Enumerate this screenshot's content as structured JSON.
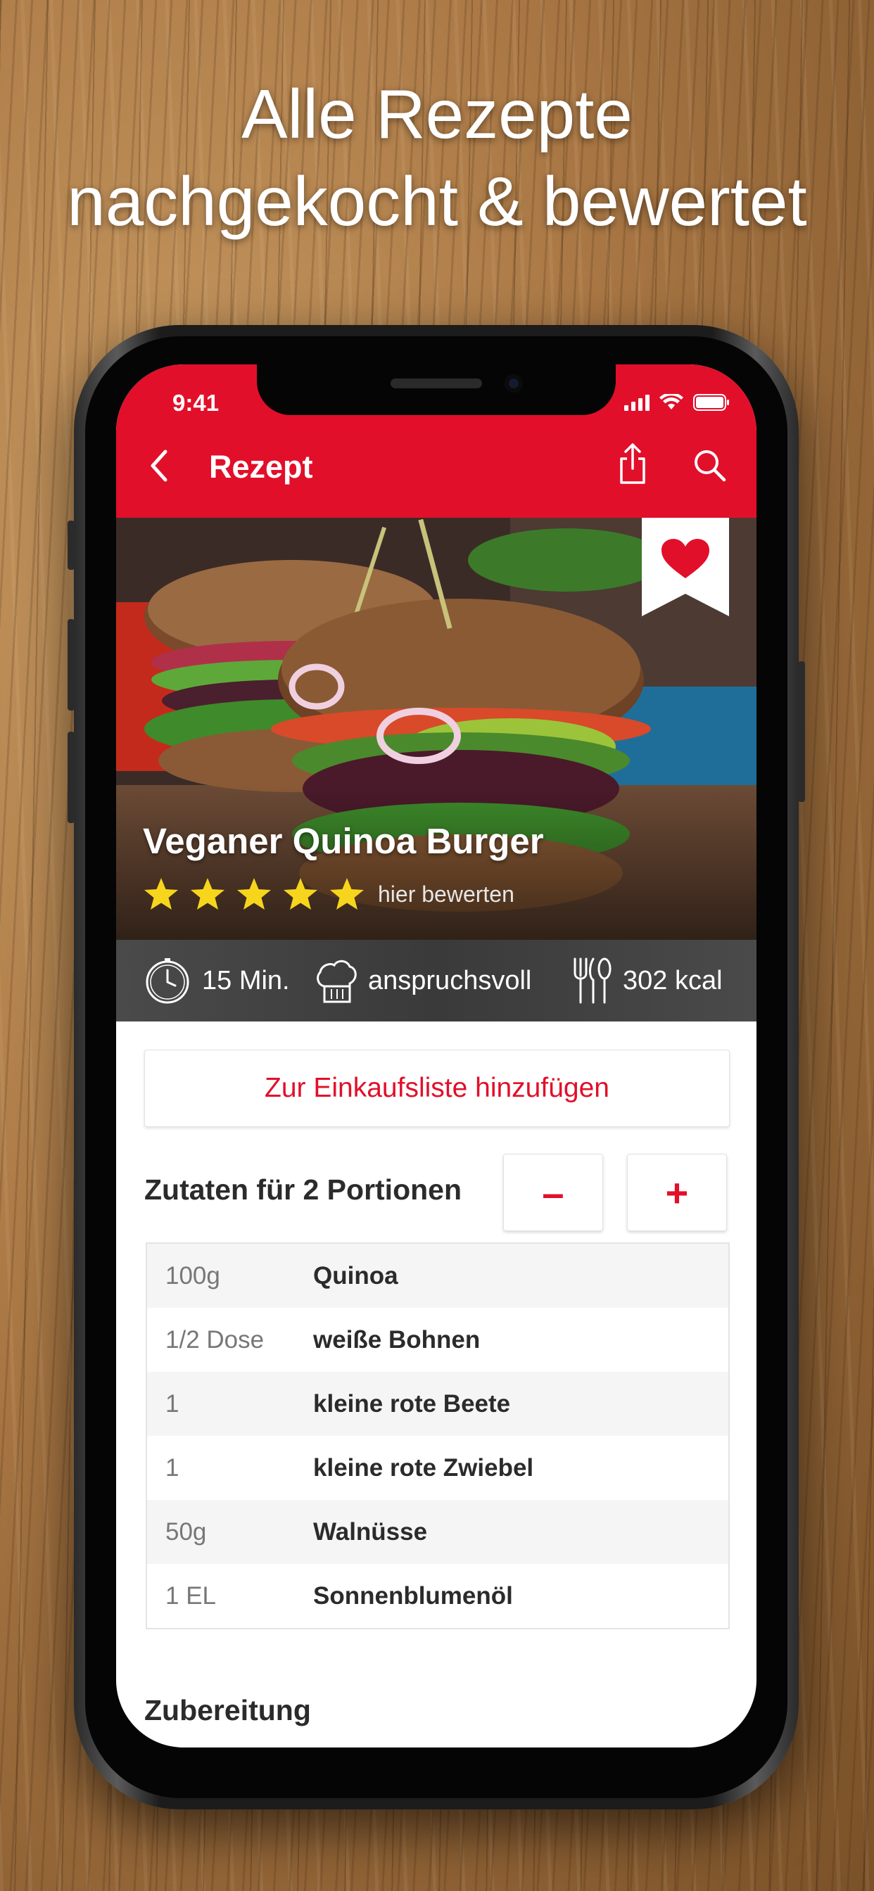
{
  "headline": {
    "line1": "Alle Rezepte",
    "line2": "nachgekocht & bewertet"
  },
  "status_bar": {
    "time": "9:41"
  },
  "nav": {
    "title": "Rezept"
  },
  "recipe": {
    "title": "Veganer Quinoa Burger",
    "rating_stars": 5,
    "rate_label": "hier bewerten",
    "favorite": true
  },
  "stats": {
    "time": "15 Min.",
    "difficulty": "anspruchsvoll",
    "calories": "302 kcal"
  },
  "shopping_list_button": "Zur Einkaufsliste hinzufügen",
  "ingredients": {
    "heading": "Zutaten für 2 Portionen",
    "decrease_label": "–",
    "increase_label": "+",
    "items": [
      {
        "qty": "100g",
        "name": "Quinoa"
      },
      {
        "qty": "1/2 Dose",
        "name": "weiße Bohnen"
      },
      {
        "qty": "1",
        "name": "kleine rote Beete"
      },
      {
        "qty": "1",
        "name": "kleine rote Zwiebel"
      },
      {
        "qty": "50g",
        "name": "Walnüsse"
      },
      {
        "qty": "1 EL",
        "name": "Sonnenblumenöl"
      }
    ]
  },
  "preparation": {
    "heading": "Zubereitung"
  },
  "colors": {
    "brand_red": "#e20f2a",
    "star_yellow": "#f7d51c",
    "stats_bar": "#3f3f3f"
  }
}
